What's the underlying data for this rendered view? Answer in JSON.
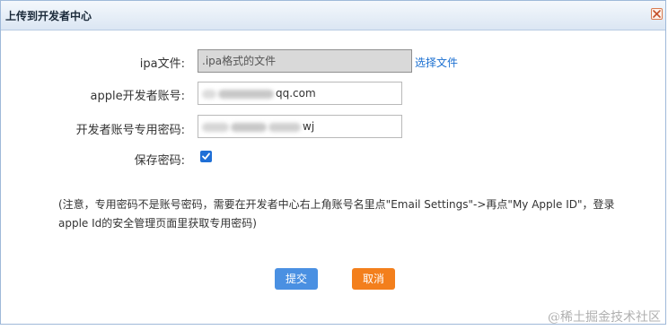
{
  "dialog": {
    "title": "上传到开发者中心"
  },
  "form": {
    "ipa_label": "ipa文件:",
    "ipa_placeholder": ".ipa格式的文件",
    "select_file_link": "选择文件",
    "apple_id_label": "apple开发者账号:",
    "apple_id_visible_suffix": "qq.com",
    "password_label": "开发者账号专用密码:",
    "password_visible_suffix": "wj",
    "save_password_label": "保存密码:",
    "save_password_checked": true
  },
  "note": {
    "text": "(注意，专用密码不是账号密码，需要在开发者中心右上角账号名里点\"Email Settings\"->再点\"My Apple ID\"，登录apple Id的安全管理页面里获取专用密码)"
  },
  "buttons": {
    "submit": "提交",
    "cancel": "取消"
  },
  "watermark": "@稀土掘金技术社区",
  "colors": {
    "submit_bg": "#4a90e2",
    "cancel_bg": "#f37f1c",
    "link": "#1a6fd1"
  }
}
